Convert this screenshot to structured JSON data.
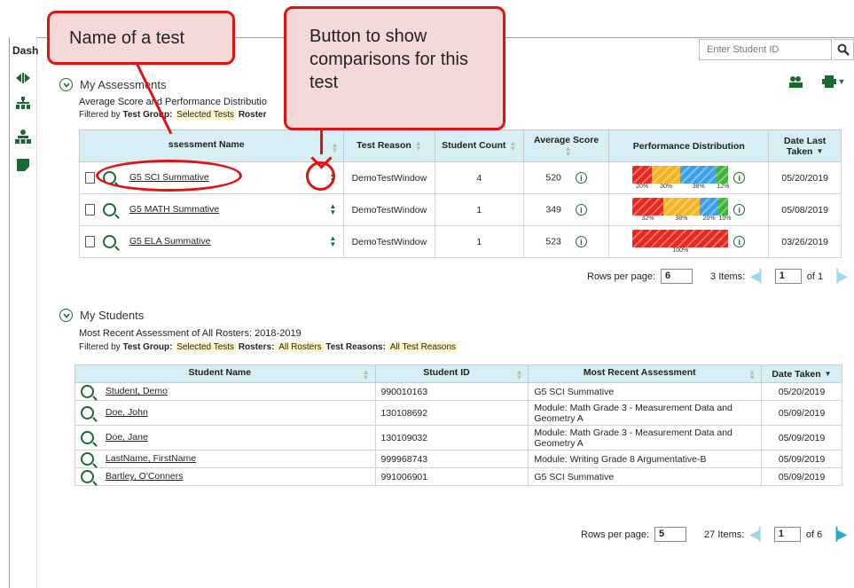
{
  "dashboard": {
    "label": "Dash"
  },
  "search": {
    "placeholder": "Enter Student ID"
  },
  "assessments": {
    "title": "My Assessments",
    "subtitle": "Average Score and Performance Distributio",
    "filter_prefix": "Filtered by",
    "filter_test_group_label": "Test Group:",
    "filter_test_group_value": "Selected Tests",
    "filter_roster_label": "Roster",
    "columns": [
      "ssessment Name",
      "Test Reason",
      "Student Count",
      "Average Score",
      "Performance Distribution",
      "Date Last Taken"
    ],
    "rows": [
      {
        "name": "G5 SCI Summative",
        "reason": "DemoTestWindow",
        "count": "4",
        "avg": "520",
        "dist": [
          20,
          30,
          38,
          12
        ],
        "dist_labels": [
          "20%",
          "30%",
          "38%",
          "12%"
        ],
        "date": "05/20/2019"
      },
      {
        "name": "G5 MATH Summative",
        "reason": "DemoTestWindow",
        "count": "1",
        "avg": "349",
        "dist": [
          32,
          38,
          20,
          10
        ],
        "dist_labels": [
          "32%",
          "38%",
          "20%",
          "10%"
        ],
        "date": "05/08/2019"
      },
      {
        "name": "G5 ELA Summative",
        "reason": "DemoTestWindow",
        "count": "1",
        "avg": "523",
        "dist": [
          100,
          0,
          0,
          0
        ],
        "dist_labels": [
          "100%",
          "",
          "",
          ""
        ],
        "date": "03/26/2019"
      }
    ],
    "pager": {
      "rows_label": "Rows per page:",
      "rows_value": "6",
      "items": "3 Items:",
      "page": "1",
      "of": "of 1"
    }
  },
  "students": {
    "title": "My Students",
    "subtitle": "Most Recent Assessment of All Rosters: 2018-2019",
    "filter_prefix": "Filtered by",
    "filter_test_group_label": "Test Group:",
    "filter_test_group_value": "Selected Tests",
    "filter_rosters_label": "Rosters:",
    "filter_rosters_value": "All Rosters",
    "filter_reasons_label": "Test Reasons:",
    "filter_reasons_value": "All Test Reasons",
    "columns": [
      "Student Name",
      "Student ID",
      "Most Recent Assessment",
      "Date Taken"
    ],
    "rows": [
      {
        "name": "Student, Demo",
        "id": "990010163",
        "assessment": "G5 SCI Summative",
        "date": "05/20/2019"
      },
      {
        "name": "Doe, John",
        "id": "130108692",
        "assessment": "Module: Math Grade 3 - Measurement Data and Geometry A",
        "date": "05/09/2019"
      },
      {
        "name": "Doe, Jane",
        "id": "130109032",
        "assessment": "Module: Math Grade 3 - Measurement Data and Geometry A",
        "date": "05/09/2019"
      },
      {
        "name": "LastName, FirstName",
        "id": "999968743",
        "assessment": "Module: Writing Grade 8 Argumentative-B",
        "date": "05/09/2019"
      },
      {
        "name": "Bartley, O'Conners",
        "id": "991006901",
        "assessment": "G5 SCI Summative",
        "date": "05/09/2019"
      }
    ],
    "pager": {
      "rows_label": "Rows per page:",
      "rows_value": "5",
      "items": "27 Items:",
      "page": "1",
      "of": "of 6"
    }
  },
  "callouts": {
    "name": "Name of a test",
    "button": "Button to show comparisons for this test"
  },
  "colors": {
    "accent": "#1a6b2f",
    "header_bg": "#d7eef4",
    "callout_border": "#e31212",
    "callout_bg": "#f5d9d9",
    "dist": [
      "#e8271f",
      "#f4b323",
      "#3da0e6",
      "#43b43a"
    ]
  }
}
